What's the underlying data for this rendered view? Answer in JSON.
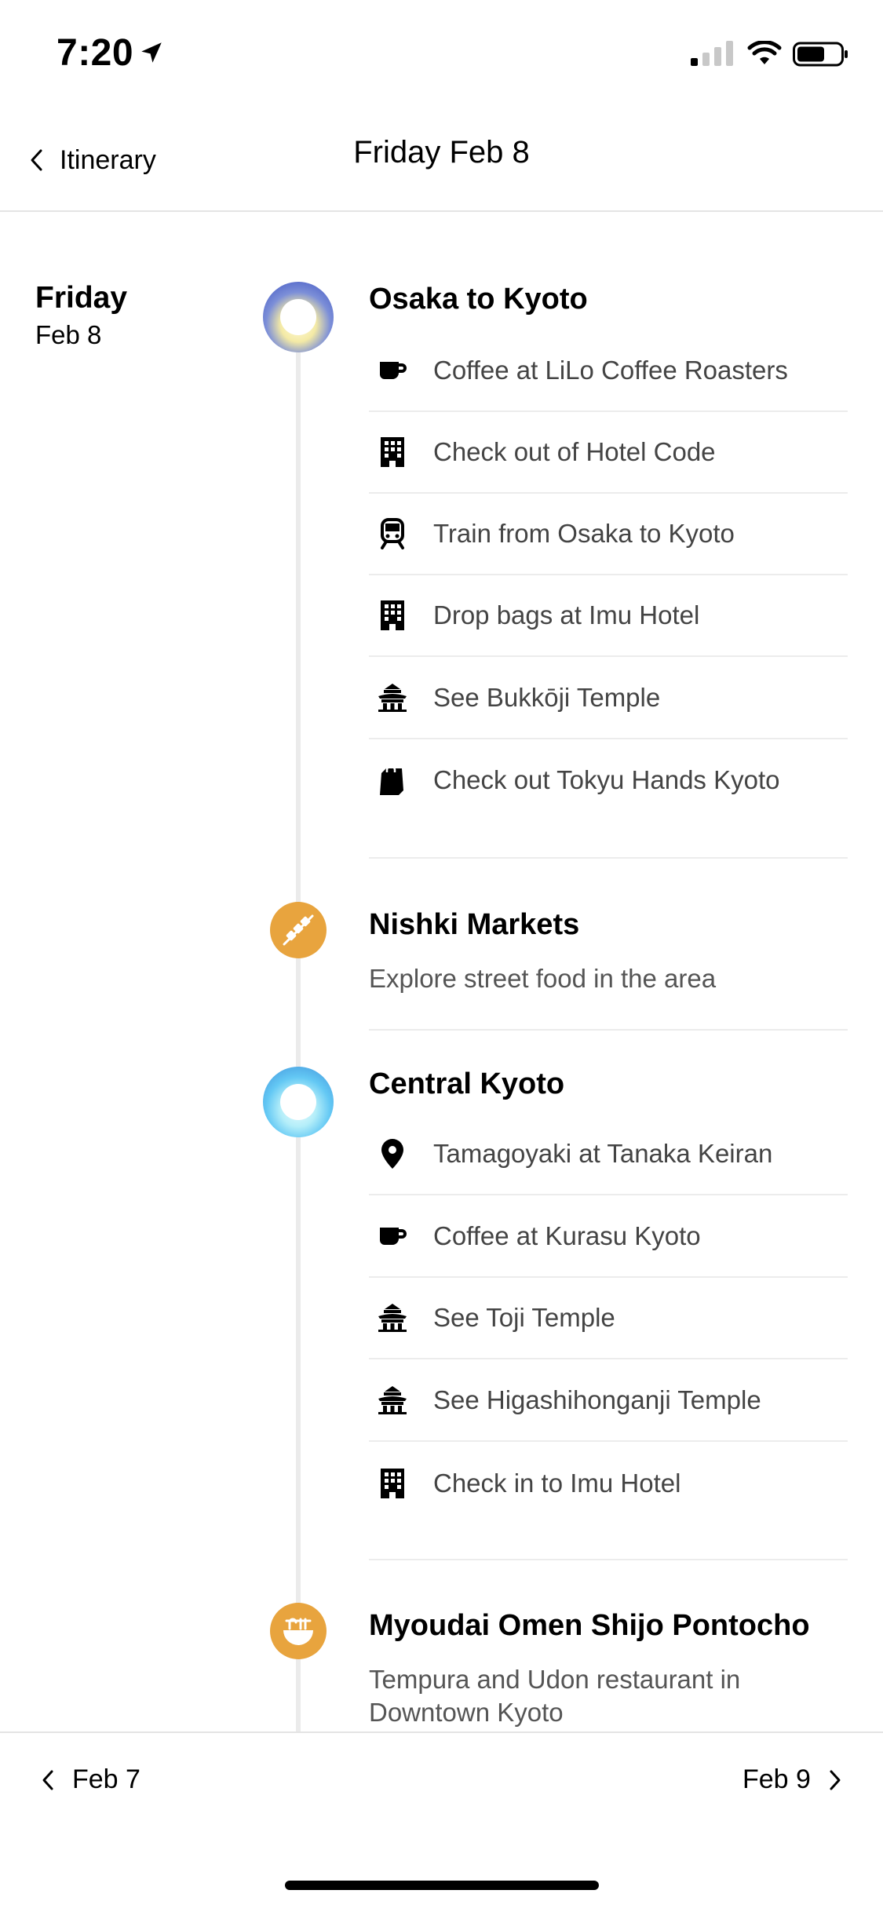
{
  "status_bar": {
    "time": "7:20"
  },
  "nav": {
    "back_label": "Itinerary",
    "title": "Friday Feb 8"
  },
  "day": {
    "name": "Friday",
    "date": "Feb 8"
  },
  "sections": [
    {
      "title": "Osaka to Kyoto",
      "items": [
        {
          "icon": "coffee-cup-icon",
          "label": "Coffee at LiLo Coffee Roasters"
        },
        {
          "icon": "hotel-building-icon",
          "label": "Check out of Hotel Code"
        },
        {
          "icon": "train-icon",
          "label": "Train from Osaka to Kyoto"
        },
        {
          "icon": "hotel-building-icon",
          "label": "Drop bags at Imu Hotel"
        },
        {
          "icon": "temple-icon",
          "label": "See Bukkōji Temple"
        },
        {
          "icon": "shopping-bag-icon",
          "label": "Check out Tokyu Hands Kyoto"
        }
      ]
    },
    {
      "title": "Nishki Markets",
      "subtitle": "Explore street food in the area",
      "icon": "skewer-icon"
    },
    {
      "title": "Central Kyoto",
      "items": [
        {
          "icon": "map-pin-icon",
          "label": "Tamagoyaki at Tanaka Keiran"
        },
        {
          "icon": "coffee-cup-icon",
          "label": "Coffee at Kurasu Kyoto"
        },
        {
          "icon": "temple-icon",
          "label": "See Toji Temple"
        },
        {
          "icon": "temple-icon",
          "label": "See Higashihonganji Temple"
        },
        {
          "icon": "hotel-building-icon",
          "label": "Check in to Imu Hotel"
        }
      ]
    },
    {
      "title": "Myoudai Omen Shijo Pontocho",
      "subtitle_line1": "Tempura and Udon restaurant in",
      "subtitle_line2": "Downtown Kyoto",
      "icon": "noodle-bowl-icon"
    }
  ],
  "footer": {
    "prev_label": "Feb 7",
    "next_label": "Feb 9"
  },
  "colors": {
    "accent_orange": "#e8a43e",
    "timeline": "#ebebeb",
    "divider": "#ececec"
  }
}
